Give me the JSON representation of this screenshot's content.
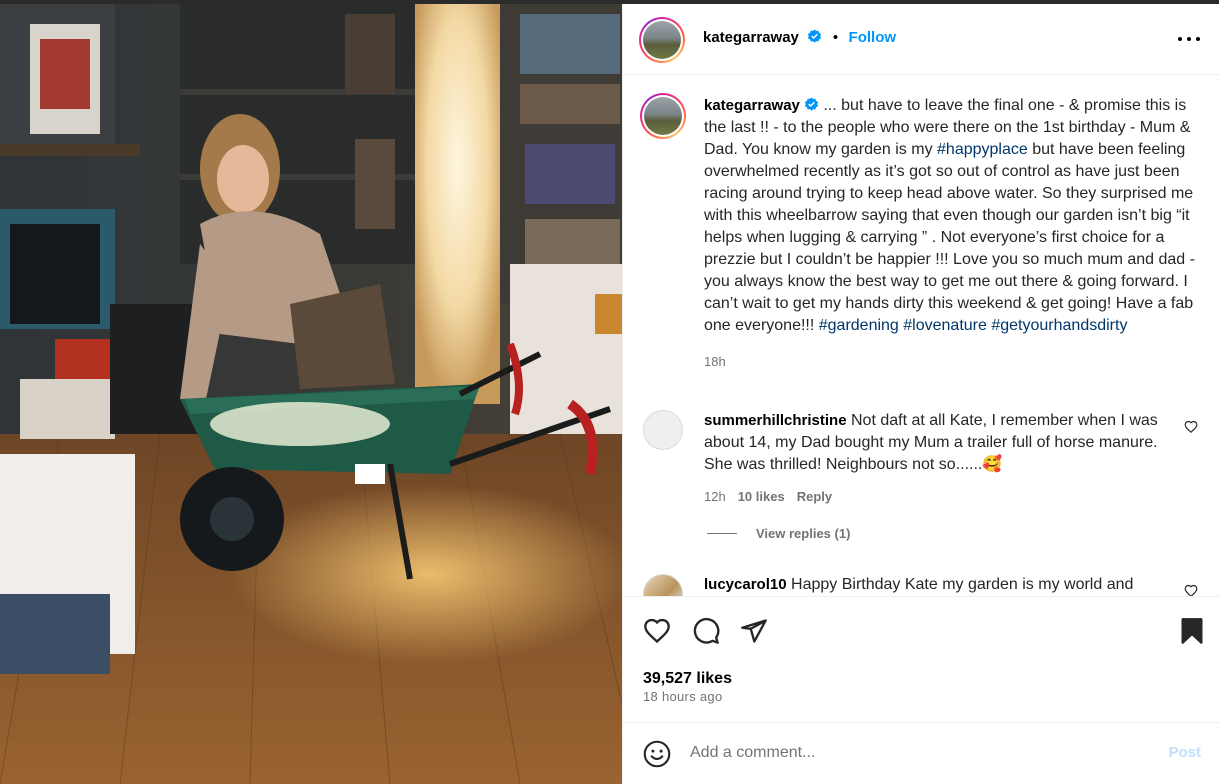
{
  "post": {
    "username": "kategarraway",
    "follow_label": "Follow",
    "caption_text": "... but have to leave the final one - & promise this is the last !! - to the people who were there on the 1st birthday - Mum & Dad. You know my garden is my",
    "caption_tag1": "#happyplace",
    "caption_text2": "but have been feeling overwhelmed recently as it’s got so out of control as have just been racing around trying to keep head above water. So they surprised me with this wheelbarrow saying that even though our garden isn’t big “it helps when lugging & carrying ” . Not everyone’s first choice for a prezzie but I couldn’t be happier !!! Love you so much mum and dad - you always know the best way to get me out there & going forward. I can’t wait to get my hands dirty this weekend & get going! Have a fab one everyone!!!",
    "caption_tags_end": [
      "#gardening",
      "#lovenature",
      "#getyourhandsdirty"
    ],
    "caption_time": "18h"
  },
  "comments": [
    {
      "username": "summerhillchristine",
      "text": "Not daft at all Kate, I remember when I was about 14, my Dad bought my Mum a trailer full of horse manure. She was thrilled! Neighbours not so......",
      "emoji": "🥰",
      "time": "12h",
      "likes": "10 likes",
      "reply_label": "Reply",
      "view_replies": "View replies (1)"
    },
    {
      "username": "lucycarol10",
      "text": "Happy Birthday Kate my garden is my world and"
    }
  ],
  "likes_count": "39,527 likes",
  "posted_ago": "18 hours ago",
  "add_comment": {
    "placeholder": "Add a comment...",
    "post_label": "Post"
  },
  "icons": [
    "more-icon",
    "verified-badge-icon",
    "like-heart-icon",
    "comment-icon",
    "share-icon",
    "save-bookmark-icon",
    "emoji-icon"
  ],
  "colors": {
    "accent": "#0095f6",
    "hashtag": "#00376b",
    "muted": "#737373",
    "post_disabled": "#c0dffd"
  }
}
